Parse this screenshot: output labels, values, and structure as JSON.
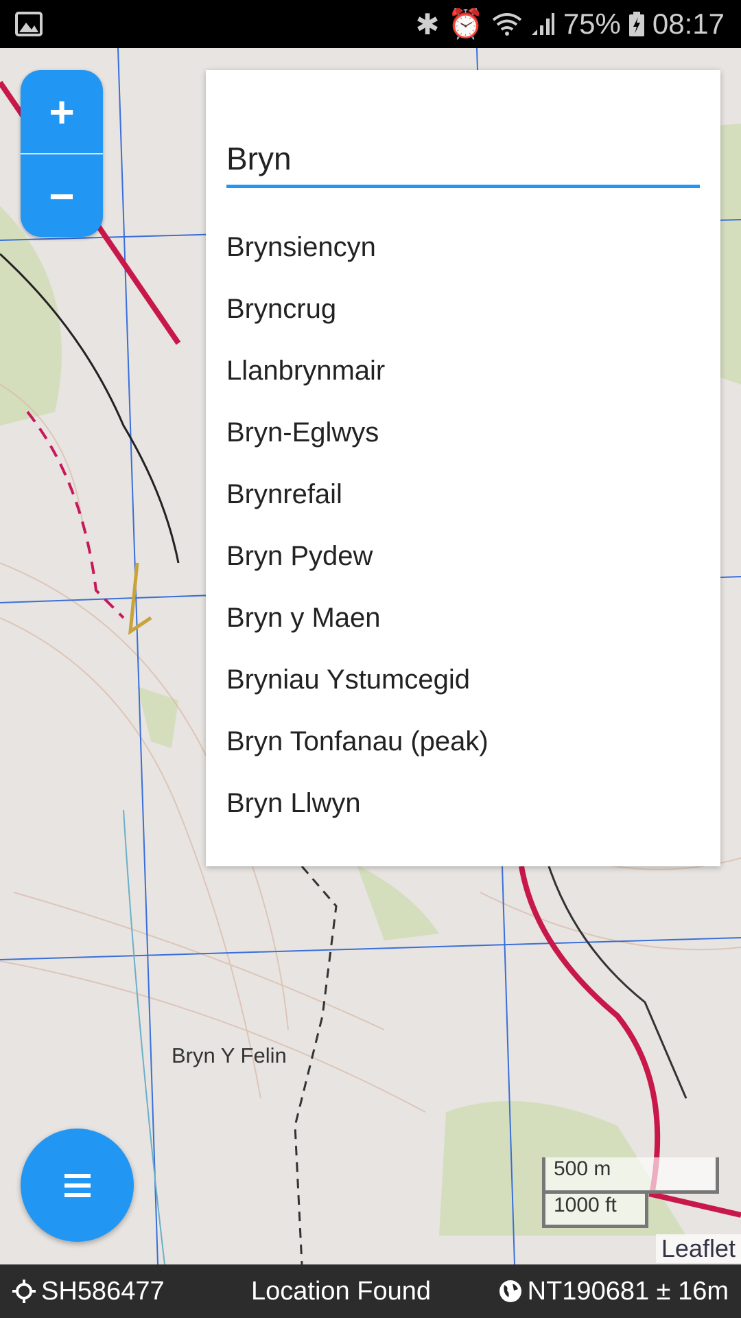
{
  "status_bar": {
    "battery": "75%",
    "time": "08:17",
    "icons": [
      "image-icon",
      "bluetooth-icon",
      "alarm-icon",
      "wifi-icon",
      "signal-icon",
      "battery-charging-icon"
    ]
  },
  "zoom": {
    "in": "+",
    "out": "−"
  },
  "search": {
    "value": "Bryn",
    "results": [
      "Brynsiencyn",
      "Bryncrug",
      "Llanbrynmair",
      "Bryn-Eglwys",
      "Brynrefail",
      "Bryn Pydew",
      "Bryn y Maen",
      "Bryniau Ystumcegid",
      "Bryn Tonfanau (peak)",
      "Bryn Llwyn"
    ]
  },
  "map": {
    "labels": [
      "Bryn Y Felin"
    ],
    "attribution": "Leaflet",
    "scale_metric": "500 m",
    "scale_imperial": "1000 ft"
  },
  "bottom_bar": {
    "grid_ref": "SH586477",
    "status": "Location Found",
    "gps": "NT190681 ± 16m"
  },
  "colors": {
    "accent": "#2196f3",
    "grid": "#3a6fd8",
    "road": "#c8184a"
  }
}
